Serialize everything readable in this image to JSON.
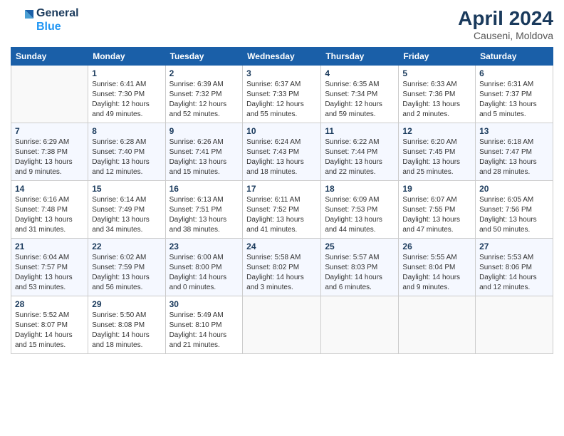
{
  "header": {
    "logo_line1": "General",
    "logo_line2": "Blue",
    "month_year": "April 2024",
    "location": "Causeni, Moldova"
  },
  "days_of_week": [
    "Sunday",
    "Monday",
    "Tuesday",
    "Wednesday",
    "Thursday",
    "Friday",
    "Saturday"
  ],
  "weeks": [
    [
      {
        "num": "",
        "info": ""
      },
      {
        "num": "1",
        "info": "Sunrise: 6:41 AM\nSunset: 7:30 PM\nDaylight: 12 hours\nand 49 minutes."
      },
      {
        "num": "2",
        "info": "Sunrise: 6:39 AM\nSunset: 7:32 PM\nDaylight: 12 hours\nand 52 minutes."
      },
      {
        "num": "3",
        "info": "Sunrise: 6:37 AM\nSunset: 7:33 PM\nDaylight: 12 hours\nand 55 minutes."
      },
      {
        "num": "4",
        "info": "Sunrise: 6:35 AM\nSunset: 7:34 PM\nDaylight: 12 hours\nand 59 minutes."
      },
      {
        "num": "5",
        "info": "Sunrise: 6:33 AM\nSunset: 7:36 PM\nDaylight: 13 hours\nand 2 minutes."
      },
      {
        "num": "6",
        "info": "Sunrise: 6:31 AM\nSunset: 7:37 PM\nDaylight: 13 hours\nand 5 minutes."
      }
    ],
    [
      {
        "num": "7",
        "info": "Sunrise: 6:29 AM\nSunset: 7:38 PM\nDaylight: 13 hours\nand 9 minutes."
      },
      {
        "num": "8",
        "info": "Sunrise: 6:28 AM\nSunset: 7:40 PM\nDaylight: 13 hours\nand 12 minutes."
      },
      {
        "num": "9",
        "info": "Sunrise: 6:26 AM\nSunset: 7:41 PM\nDaylight: 13 hours\nand 15 minutes."
      },
      {
        "num": "10",
        "info": "Sunrise: 6:24 AM\nSunset: 7:43 PM\nDaylight: 13 hours\nand 18 minutes."
      },
      {
        "num": "11",
        "info": "Sunrise: 6:22 AM\nSunset: 7:44 PM\nDaylight: 13 hours\nand 22 minutes."
      },
      {
        "num": "12",
        "info": "Sunrise: 6:20 AM\nSunset: 7:45 PM\nDaylight: 13 hours\nand 25 minutes."
      },
      {
        "num": "13",
        "info": "Sunrise: 6:18 AM\nSunset: 7:47 PM\nDaylight: 13 hours\nand 28 minutes."
      }
    ],
    [
      {
        "num": "14",
        "info": "Sunrise: 6:16 AM\nSunset: 7:48 PM\nDaylight: 13 hours\nand 31 minutes."
      },
      {
        "num": "15",
        "info": "Sunrise: 6:14 AM\nSunset: 7:49 PM\nDaylight: 13 hours\nand 34 minutes."
      },
      {
        "num": "16",
        "info": "Sunrise: 6:13 AM\nSunset: 7:51 PM\nDaylight: 13 hours\nand 38 minutes."
      },
      {
        "num": "17",
        "info": "Sunrise: 6:11 AM\nSunset: 7:52 PM\nDaylight: 13 hours\nand 41 minutes."
      },
      {
        "num": "18",
        "info": "Sunrise: 6:09 AM\nSunset: 7:53 PM\nDaylight: 13 hours\nand 44 minutes."
      },
      {
        "num": "19",
        "info": "Sunrise: 6:07 AM\nSunset: 7:55 PM\nDaylight: 13 hours\nand 47 minutes."
      },
      {
        "num": "20",
        "info": "Sunrise: 6:05 AM\nSunset: 7:56 PM\nDaylight: 13 hours\nand 50 minutes."
      }
    ],
    [
      {
        "num": "21",
        "info": "Sunrise: 6:04 AM\nSunset: 7:57 PM\nDaylight: 13 hours\nand 53 minutes."
      },
      {
        "num": "22",
        "info": "Sunrise: 6:02 AM\nSunset: 7:59 PM\nDaylight: 13 hours\nand 56 minutes."
      },
      {
        "num": "23",
        "info": "Sunrise: 6:00 AM\nSunset: 8:00 PM\nDaylight: 14 hours\nand 0 minutes."
      },
      {
        "num": "24",
        "info": "Sunrise: 5:58 AM\nSunset: 8:02 PM\nDaylight: 14 hours\nand 3 minutes."
      },
      {
        "num": "25",
        "info": "Sunrise: 5:57 AM\nSunset: 8:03 PM\nDaylight: 14 hours\nand 6 minutes."
      },
      {
        "num": "26",
        "info": "Sunrise: 5:55 AM\nSunset: 8:04 PM\nDaylight: 14 hours\nand 9 minutes."
      },
      {
        "num": "27",
        "info": "Sunrise: 5:53 AM\nSunset: 8:06 PM\nDaylight: 14 hours\nand 12 minutes."
      }
    ],
    [
      {
        "num": "28",
        "info": "Sunrise: 5:52 AM\nSunset: 8:07 PM\nDaylight: 14 hours\nand 15 minutes."
      },
      {
        "num": "29",
        "info": "Sunrise: 5:50 AM\nSunset: 8:08 PM\nDaylight: 14 hours\nand 18 minutes."
      },
      {
        "num": "30",
        "info": "Sunrise: 5:49 AM\nSunset: 8:10 PM\nDaylight: 14 hours\nand 21 minutes."
      },
      {
        "num": "",
        "info": ""
      },
      {
        "num": "",
        "info": ""
      },
      {
        "num": "",
        "info": ""
      },
      {
        "num": "",
        "info": ""
      }
    ]
  ]
}
